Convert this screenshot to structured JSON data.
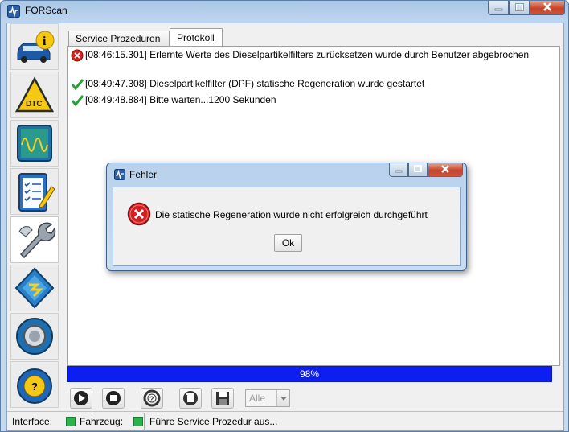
{
  "window": {
    "title": "FORScan"
  },
  "tabs": [
    {
      "label": "Service Prozeduren"
    },
    {
      "label": "Protokoll"
    }
  ],
  "log": [
    {
      "status": "error",
      "text": "[08:46:15.301] Erlernte Werte des Dieselpartikelfilters zurücksetzen wurde durch Benutzer abgebrochen"
    },
    {
      "status": "ok",
      "text": "[08:49:47.308] Dieselpartikelfilter (DPF) statische Regeneration wurde gestartet"
    },
    {
      "status": "ok",
      "text": "[08:49:48.884] Bitte warten...1200 Sekunden"
    }
  ],
  "progress": {
    "value": 98,
    "label": "98%"
  },
  "toolbar": {
    "filter_value": "Alle"
  },
  "statusbar": {
    "interface_label": "Interface:",
    "vehicle_label": "Fahrzeug:",
    "message": "Führe Service Prozedur aus..."
  },
  "dialog": {
    "title": "Fehler",
    "message": "Die statische Regeneration wurde nicht erfolgreich durchgeführt",
    "ok_label": "Ok"
  },
  "sidebar_icons": [
    "vehicle-info-icon",
    "dtc-icon",
    "oscilloscope-icon",
    "checklist-icon",
    "service-wrench-icon",
    "module-config-icon",
    "settings-gear-icon",
    "help-steering-icon"
  ],
  "colors": {
    "progress": "#0c1ef0",
    "led": "#2cb24a",
    "error": "#d32020",
    "ok": "#27a03a"
  }
}
